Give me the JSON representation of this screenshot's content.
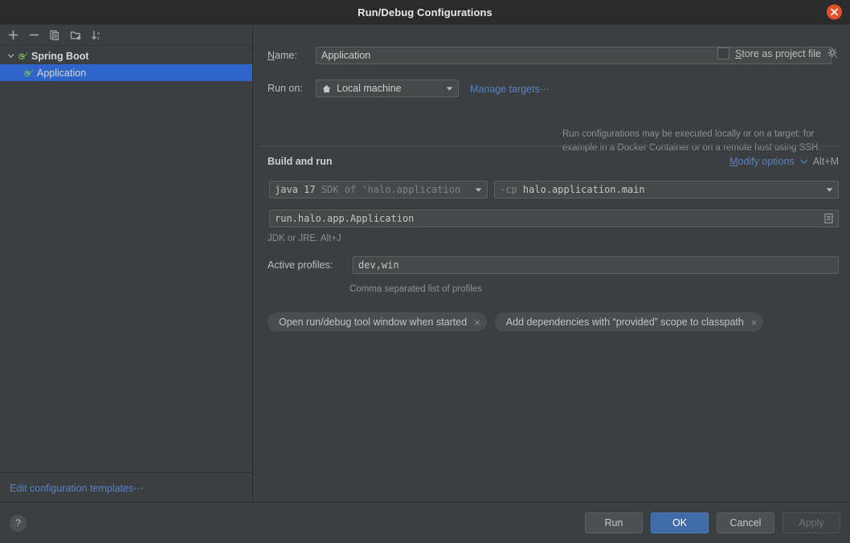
{
  "window": {
    "title": "Run/Debug Configurations",
    "close_icon": "close-icon"
  },
  "sidebar": {
    "toolbar": [
      {
        "name": "add-configuration-button",
        "icon": "plus-icon"
      },
      {
        "name": "remove-configuration-button",
        "icon": "minus-icon"
      },
      {
        "name": "copy-configuration-button",
        "icon": "copy-icon"
      },
      {
        "name": "move-into-folder-button",
        "icon": "folder-add-icon"
      },
      {
        "name": "sort-configurations-button",
        "icon": "sort-alpha-icon"
      }
    ],
    "tree": [
      {
        "label": "Spring Boot",
        "icon": "spring-boot-icon",
        "expanded": true,
        "selected": false
      },
      {
        "label": "Application",
        "icon": "spring-boot-icon",
        "expanded": false,
        "selected": true
      }
    ],
    "edit_templates_link": "Edit configuration templates⋯"
  },
  "form": {
    "name_label": "Name:",
    "name_value": "Application",
    "name_placeholder": "",
    "store_as_project_file_label": "Store as project file",
    "store_as_project_file_checked": false,
    "store_gear_icon": "gear-icon",
    "run_on_label": "Run on:",
    "run_on_value": "Local machine",
    "run_on_icon": "home-icon",
    "manage_targets_link": "Manage targets⋯",
    "run_on_hint_line1": "Run configurations may be executed locally or on a target: for",
    "run_on_hint_line2": "example in a Docker Container or on a remote host using SSH.",
    "build_and_run_title": "Build and run",
    "modify_options_link": "Modify options",
    "modify_options_shortcut": "Alt+M",
    "jdk_prefix": "java 17",
    "jdk_suffix": " SDK of 'halo.application",
    "classpath_prefix": "-cp",
    "classpath_value": "halo.application.main",
    "main_class_value": "run.halo.app.Application",
    "main_class_browse_icon": "browse-list-icon",
    "jdk_hint": "JDK or JRE. Alt+J",
    "active_profiles_label": "Active profiles:",
    "active_profiles_value": "dev,win",
    "active_profiles_hint": "Comma separated list of profiles",
    "chips": [
      {
        "label": "Open run/debug tool window when started",
        "close": "×"
      },
      {
        "label_part1": "Add dependencies with",
        "label_quoted": "“provided”",
        "label_part2": "scope to classpath",
        "close": "×"
      }
    ]
  },
  "footer": {
    "help_label": "?",
    "buttons": [
      {
        "label": "Run",
        "style": "normal"
      },
      {
        "label": "OK",
        "style": "default"
      },
      {
        "label": "Cancel",
        "style": "normal"
      },
      {
        "label": "Apply",
        "style": "disabled"
      }
    ]
  },
  "colors": {
    "accent_blue": "#5781c4",
    "selection_blue": "#2f65ca",
    "default_button_blue": "#3f6ba8",
    "close_orange": "#e2512a",
    "spring_green": "#6db33f",
    "background": "#3c3f41",
    "titlebar": "#2b2b2b"
  }
}
